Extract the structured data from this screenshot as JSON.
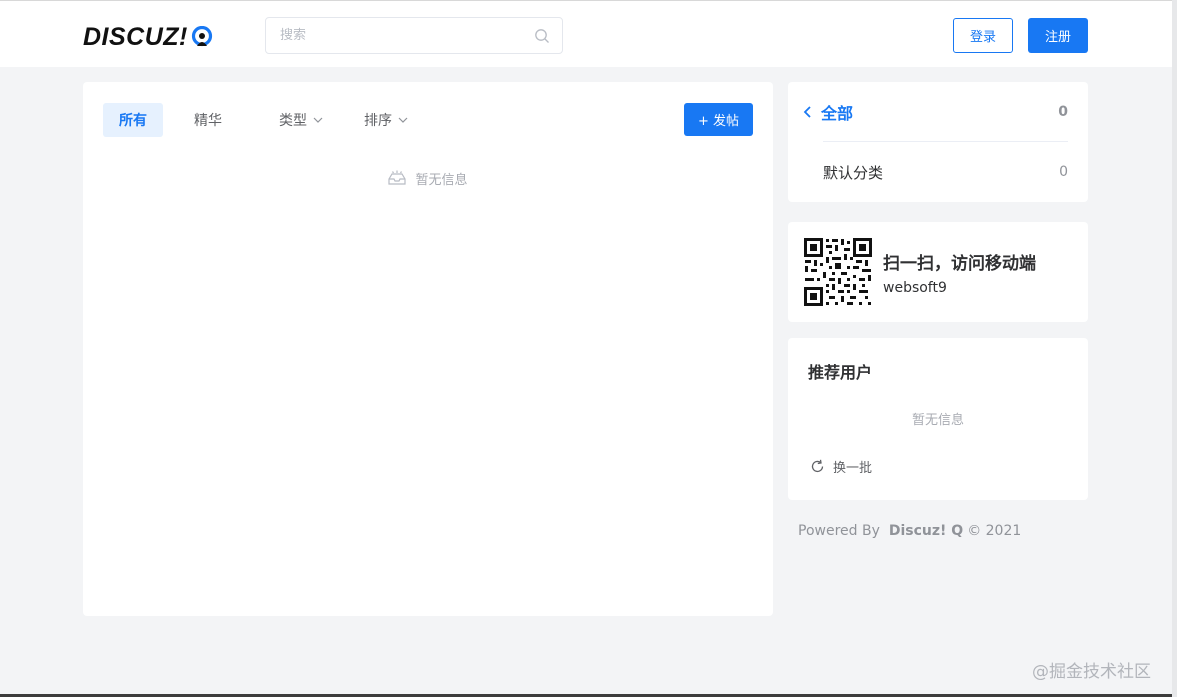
{
  "header": {
    "logo_text": "DISCUZ!",
    "logo_letter": "Q",
    "search_placeholder": "搜索",
    "login_label": "登录",
    "register_label": "注册"
  },
  "main": {
    "tabs": [
      {
        "label": "所有",
        "active": true
      },
      {
        "label": "精华",
        "active": false
      },
      {
        "label": "类型",
        "dropdown": true
      },
      {
        "label": "排序",
        "dropdown": true
      }
    ],
    "post_button_label": "+ 发帖",
    "empty_text": "暂无信息"
  },
  "categories": {
    "all_label": "全部",
    "all_count": "0",
    "items": [
      {
        "label": "默认分类",
        "count": "0"
      }
    ]
  },
  "qr": {
    "title": "扫一扫，访问移动端",
    "subtitle": "websoft9"
  },
  "recommended": {
    "title": "推荐用户",
    "empty_text": "暂无信息",
    "refresh_label": "换一批"
  },
  "footer": {
    "powered_by": "Powered By",
    "brand": "Discuz! Q",
    "copyright": "© 2021"
  },
  "watermark": "@掘金技术社区",
  "colors": {
    "primary": "#1878f3",
    "background": "#f3f4f6",
    "muted": "#909399"
  }
}
